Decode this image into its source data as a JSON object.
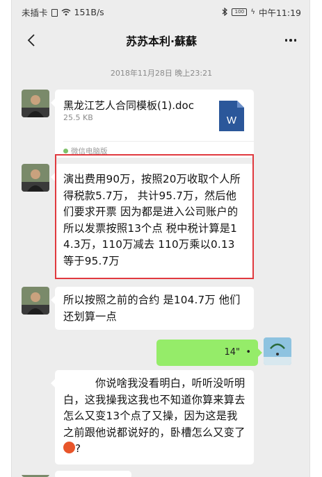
{
  "status_bar": {
    "carrier": "未插卡",
    "speed": "151B/s",
    "battery": "100",
    "time": "中午11:19"
  },
  "nav": {
    "title": "苏苏本利·蘇蘇",
    "back_icon": "chevron-left-icon",
    "more_icon": "more-dots-icon"
  },
  "chat": {
    "timestamp": "2018年11月28日 晚上23:21",
    "file_message": {
      "file_name": "黑龙江艺人合同模板(1).doc",
      "file_size": "25.5 KB",
      "file_icon_letter": "W",
      "source": "微信电脑版"
    },
    "messages": [
      {
        "side": "left",
        "text": "演出费用90万，按照20万收取个人所得税款5.7万，  共计95.7万，然后他们要求开票 因为都是进入公司账户的 所以发票按照13个点 税中税计算是14.3万，110万减去 110万乘以0.13  等于95.7万",
        "highlighted": true
      },
      {
        "side": "left",
        "text": "所以按照之前的合约 是104.7万 他们还划算一点"
      }
    ],
    "voice_message": {
      "side": "right",
      "duration": "14\""
    },
    "last_message": {
      "side": "left",
      "text": "你说啥我没看明白，听听没听明白，这我操我这我也不知道你算来算去怎么又变13个点了又操，因为这是我之前跟他说都说好的，卧槽怎么又变了",
      "suffix": "?"
    }
  },
  "colors": {
    "chat_bg": "#ededed",
    "outgoing_bubble": "#95ec69",
    "highlight_border": "#e0393e",
    "word_blue": "#2b579a"
  }
}
